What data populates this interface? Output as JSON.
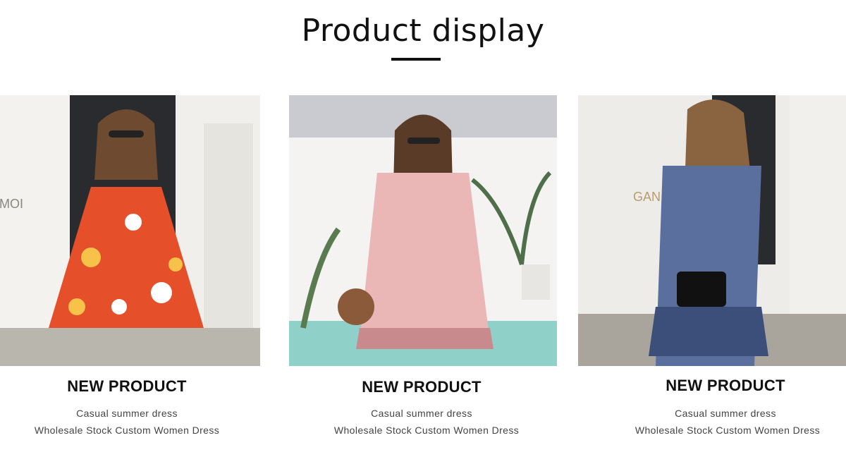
{
  "header": {
    "title": "Product display"
  },
  "products": [
    {
      "badge": "NEW PRODUCT",
      "line1": "Casual summer dress",
      "line2": "Wholesale Stock Custom Women Dress",
      "dress_color": "#e5502b",
      "alt_color": "#f7c24a"
    },
    {
      "badge": "NEW PRODUCT",
      "line1": "Casual summer dress",
      "line2": "Wholesale Stock Custom Women Dress",
      "dress_color": "#eab7b6",
      "alt_color": "#c98a8e"
    },
    {
      "badge": "NEW PRODUCT",
      "line1": "Casual summer dress",
      "line2": "Wholesale Stock Custom Women Dress",
      "dress_color": "#5b6f9e",
      "alt_color": "#3c4e7a"
    }
  ]
}
